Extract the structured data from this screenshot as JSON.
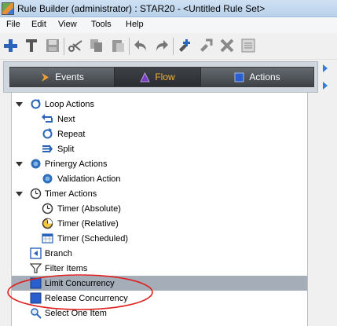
{
  "window": {
    "title": "Rule Builder (administrator) : STAR20 - <Untitled Rule Set>"
  },
  "menu": [
    "File",
    "Edit",
    "View",
    "Tools",
    "Help"
  ],
  "toolbar": {
    "buttons": [
      "new-icon",
      "build-icon",
      "save-icon",
      "cut-icon",
      "copy-icon",
      "paste-icon",
      "undo-icon",
      "redo-icon",
      "add-rule-icon",
      "test-icon",
      "delete-icon",
      "properties-icon"
    ]
  },
  "tabs": [
    {
      "label": "Events",
      "icon": "arrow-right-icon",
      "color": "#f0a030",
      "active": false
    },
    {
      "label": "Flow",
      "icon": "triangle-icon",
      "color": "#7b3fc4",
      "active": true
    },
    {
      "label": "Actions",
      "icon": "square-icon",
      "color": "#2a5fcf",
      "active": false
    }
  ],
  "tree": {
    "loop_actions": {
      "label": "Loop Actions",
      "children": [
        "Next",
        "Repeat",
        "Split"
      ]
    },
    "prinergy_actions": {
      "label": "Prinergy Actions",
      "children": [
        "Validation Action"
      ]
    },
    "timer_actions": {
      "label": "Timer Actions",
      "children": [
        "Timer (Absolute)",
        "Timer (Relative)",
        "Timer (Scheduled)"
      ]
    },
    "items": [
      "Branch",
      "Filter Items",
      "Limit Concurrency",
      "Release Concurrency",
      "Select One Item"
    ],
    "selected": "Limit Concurrency"
  },
  "colors": {
    "annotation": "#e02020",
    "selection": "#a4adb8"
  }
}
